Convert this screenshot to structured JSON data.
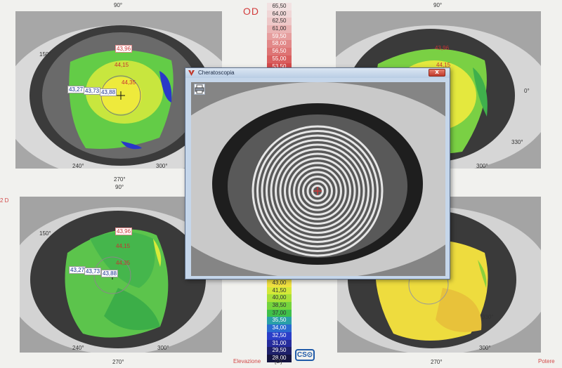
{
  "header": {
    "eye": "OD"
  },
  "scale": {
    "top_values": [
      "65,50",
      "64,00",
      "62,50",
      "61,00",
      "59,50",
      "58,00",
      "56,50",
      "55,00",
      "53,50"
    ],
    "top_colors": [
      "#f2e2e2",
      "#f0d6d6",
      "#eec8c8",
      "#eab4b4",
      "#e69e9e",
      "#e28888",
      "#de7474",
      "#d95e5e",
      "#d44a4a"
    ],
    "bottom_values": [
      "43,00",
      "41,50",
      "40,00",
      "38,50",
      "37,00",
      "35,50",
      "34,00",
      "32,50",
      "31,00",
      "29,50",
      "28,00"
    ],
    "bottom_colors": [
      "#f0e040",
      "#d4e838",
      "#a8e038",
      "#74d43c",
      "#3fc04a",
      "#2aa0a8",
      "#2a6ad0",
      "#2a3ec8",
      "#262c9c",
      "#1e206a",
      "#141440"
    ],
    "unit": "[D]"
  },
  "labels": {
    "deg_90": "90°",
    "deg_270": "270°",
    "deg_240": "240°",
    "deg_300": "300°",
    "deg_330": "330°",
    "deg_0": "0°",
    "deg_150": "150°",
    "elevazione": "Elevazione",
    "potere": "Potere",
    "left_mark": "2 D"
  },
  "maps": {
    "top_left": {
      "values": [
        "43,96",
        "44,15",
        "44,35",
        "43,27",
        "43,73",
        "43,88"
      ]
    },
    "bottom_left": {
      "values": [
        "43,96",
        "44,15",
        "44,35",
        "43,27",
        "43,73",
        "43,88"
      ]
    },
    "top_right": {
      "values": [
        "43,96",
        "44,15"
      ]
    }
  },
  "dialog": {
    "title": "Cheratoscopia",
    "close_label": "x"
  },
  "brand": {
    "logo_text": "CS⊙"
  },
  "colors": {
    "close_red": "#c0392b",
    "accent_blue": "#1f5aa8",
    "od_red": "#d23c3c"
  }
}
